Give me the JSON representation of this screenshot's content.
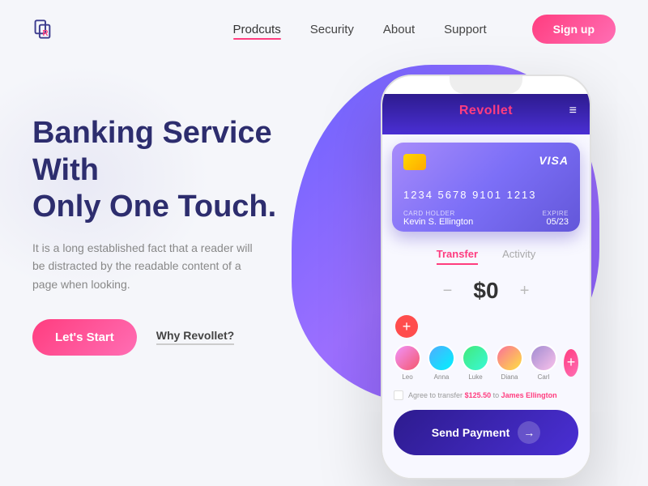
{
  "logo": {
    "text": "R"
  },
  "nav": {
    "links": [
      {
        "label": "Prodcuts",
        "active": true
      },
      {
        "label": "Security",
        "active": false
      },
      {
        "label": "About",
        "active": false
      },
      {
        "label": "Support",
        "active": false
      }
    ],
    "signup": "Sign up"
  },
  "hero": {
    "title_line1": "Banking Service With",
    "title_line2": "Only One Touch.",
    "description": "It is a long established fact that a reader will be distracted by the readable content of a page when looking.",
    "cta_primary": "Let's Start",
    "cta_secondary": "Why Revollet?"
  },
  "phone": {
    "app_name_part1": "Revol",
    "app_name_part2": "let",
    "card": {
      "number": "1234   5678   9101   1213",
      "brand": "VISA",
      "holder_label": "CARD HOLDER",
      "holder_name": "Kevin S. Ellington",
      "expire_label": "EXPIRE",
      "expire_date": "05/23"
    },
    "tabs": [
      {
        "label": "Transfer",
        "active": true
      },
      {
        "label": "Activity",
        "active": false
      }
    ],
    "amount": "$0",
    "avatars": [
      {
        "name": "Leo",
        "color": "av1"
      },
      {
        "name": "Anna",
        "color": "av2"
      },
      {
        "name": "Luke",
        "color": "av3"
      },
      {
        "name": "Diana",
        "color": "av4"
      },
      {
        "name": "Carl",
        "color": "av5"
      }
    ],
    "agree_text_prefix": "Agree to transfer",
    "agree_amount": "$125.50",
    "agree_text_mid": " to ",
    "agree_person": "James Ellington",
    "send_payment": "Send Payment"
  }
}
